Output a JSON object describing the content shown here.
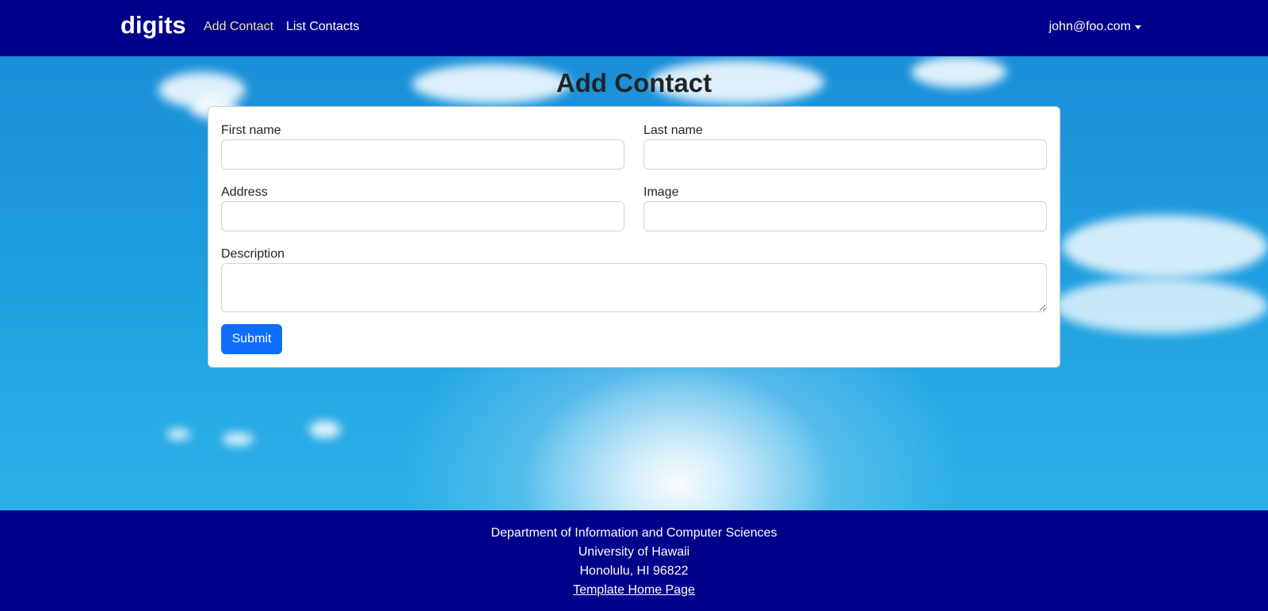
{
  "navbar": {
    "brand": "digits",
    "links": [
      {
        "label": "Add Contact",
        "active": true
      },
      {
        "label": "List Contacts",
        "active": false
      }
    ],
    "user": "john@foo.com"
  },
  "page": {
    "title": "Add Contact"
  },
  "form": {
    "fields": {
      "first_name": {
        "label": "First name",
        "value": "",
        "placeholder": ""
      },
      "last_name": {
        "label": "Last name",
        "value": "",
        "placeholder": ""
      },
      "address": {
        "label": "Address",
        "value": "",
        "placeholder": ""
      },
      "image": {
        "label": "Image",
        "value": "",
        "placeholder": ""
      },
      "description": {
        "label": "Description",
        "value": "",
        "placeholder": ""
      }
    },
    "submit_label": "Submit"
  },
  "footer": {
    "lines": [
      "Department of Information and Computer Sciences",
      "University of Hawaii",
      "Honolulu, HI 96822"
    ],
    "link_label": "Template Home Page"
  },
  "colors": {
    "navbar_bg": "#00008b",
    "active_link": "#f0e3a0",
    "submit_bg": "#0d6efd"
  }
}
